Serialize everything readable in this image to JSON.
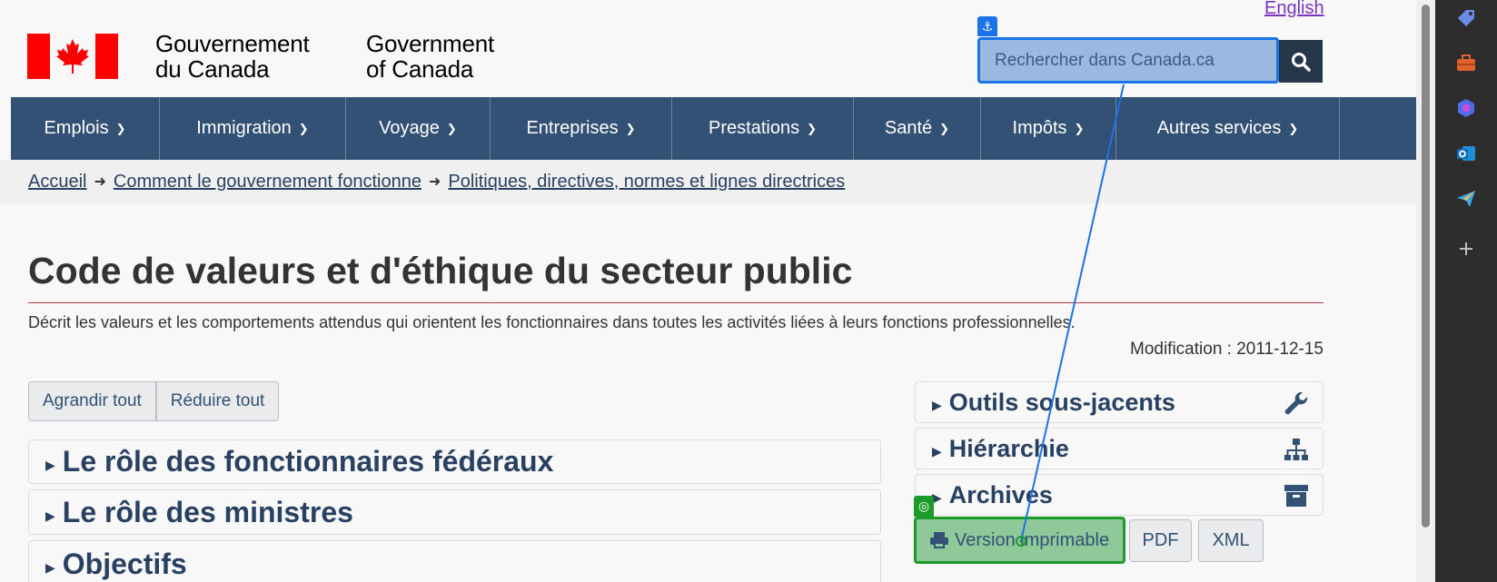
{
  "header": {
    "language_link": "English",
    "signature_fr": [
      "Gouvernement",
      "du Canada"
    ],
    "signature_en": [
      "Government",
      "of Canada"
    ],
    "search_placeholder": "Rechercher dans Canada.ca",
    "search_icon": "magnifier-icon",
    "overlay_anchor_icon": "anchor-icon"
  },
  "nav": {
    "items": [
      "Emplois",
      "Immigration",
      "Voyage",
      "Entreprises",
      "Prestations",
      "Santé",
      "Impôts",
      "Autres services"
    ]
  },
  "breadcrumb": {
    "items": [
      "Accueil",
      "Comment le gouvernement fonctionne",
      "Politiques, directives, normes et lignes directrices"
    ],
    "separator": "➜"
  },
  "main": {
    "title": "Code de valeurs et d'éthique du secteur public",
    "description": "Décrit les valeurs et les comportements attendus qui orientent les fonctionnaires dans toutes les activités liées à leurs fonctions professionnelles.",
    "modified": "Modification : 2011-12-15",
    "expand_all": "Agrandir tout",
    "collapse_all": "Réduire tout",
    "sections": [
      "Le rôle des fonctionnaires fédéraux",
      "Le rôle des ministres",
      "Objectifs"
    ],
    "triangle": "▶"
  },
  "sidebar": {
    "panels": [
      {
        "label": "Outils sous-jacents",
        "icon": "wrench-icon"
      },
      {
        "label": "Hiérarchie",
        "icon": "sitemap-icon"
      },
      {
        "label": "Archives",
        "icon": "archive-icon"
      }
    ],
    "formats": {
      "print": "Version imprimable",
      "print_icon": "printer-icon",
      "pdf": "PDF",
      "xml": "XML"
    },
    "overlay_target_icon": "target-icon"
  },
  "colors": {
    "nav_bg": "#335075",
    "link": "#284162",
    "accent_line": "#af3c43",
    "flag_red": "#ff0000",
    "anchor_blue": "#1a73e8",
    "target_green": "#1c9a2a"
  },
  "right_rail": {
    "icons": [
      "tag-icon",
      "toolbox-icon",
      "copilot-icon",
      "outlook-icon",
      "send-icon",
      "plus-icon"
    ]
  }
}
